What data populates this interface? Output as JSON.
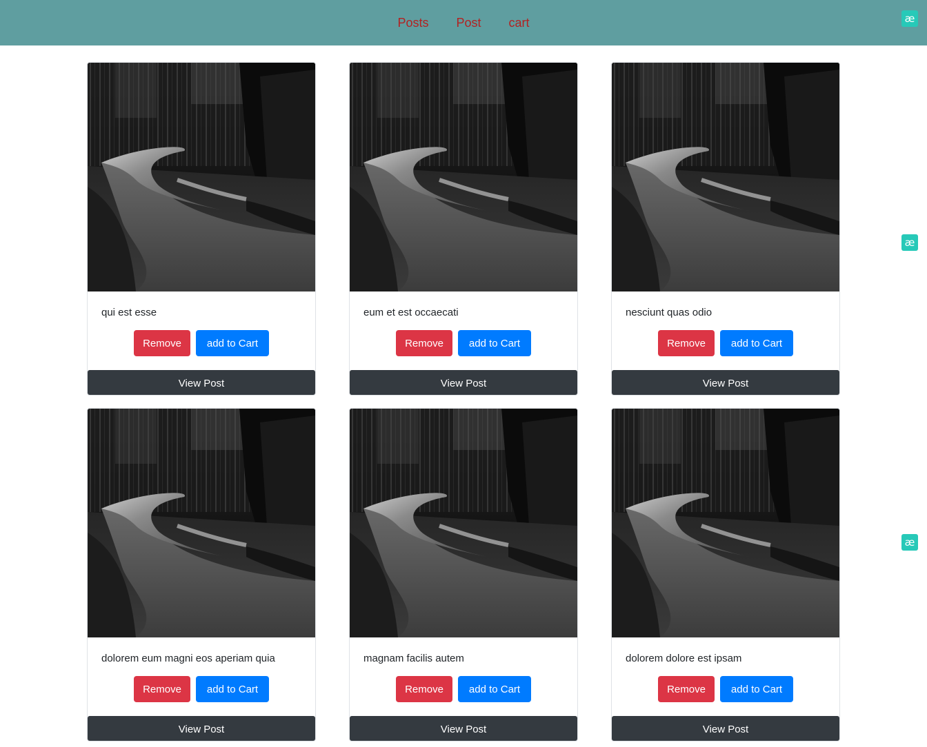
{
  "nav": {
    "links": [
      "Posts",
      "Post",
      "cart"
    ]
  },
  "extension_badge": {
    "glyph": "æ",
    "icon": "extension-ae-icon",
    "color": "#27c9b8"
  },
  "colors": {
    "navbar": "#5f9ea0",
    "nav_link": "#b22222",
    "remove": "#dc3545",
    "add": "#007bff",
    "view": "#343a40"
  },
  "cards": [
    {
      "title": "qui est esse",
      "remove_label": "Remove",
      "add_label": "add to Cart",
      "view_label": "View Post",
      "image": "forest-road-photo"
    },
    {
      "title": "eum et est occaecati",
      "remove_label": "Remove",
      "add_label": "add to Cart",
      "view_label": "View Post",
      "image": "forest-road-photo"
    },
    {
      "title": "nesciunt quas odio",
      "remove_label": "Remove",
      "add_label": "add to Cart",
      "view_label": "View Post",
      "image": "forest-road-photo"
    },
    {
      "title": "dolorem eum magni eos aperiam quia",
      "remove_label": "Remove",
      "add_label": "add to Cart",
      "view_label": "View Post",
      "image": "forest-road-photo"
    },
    {
      "title": "magnam facilis autem",
      "remove_label": "Remove",
      "add_label": "add to Cart",
      "view_label": "View Post",
      "image": "forest-road-photo"
    },
    {
      "title": "dolorem dolore est ipsam",
      "remove_label": "Remove",
      "add_label": "add to Cart",
      "view_label": "View Post",
      "image": "forest-road-photo"
    }
  ]
}
